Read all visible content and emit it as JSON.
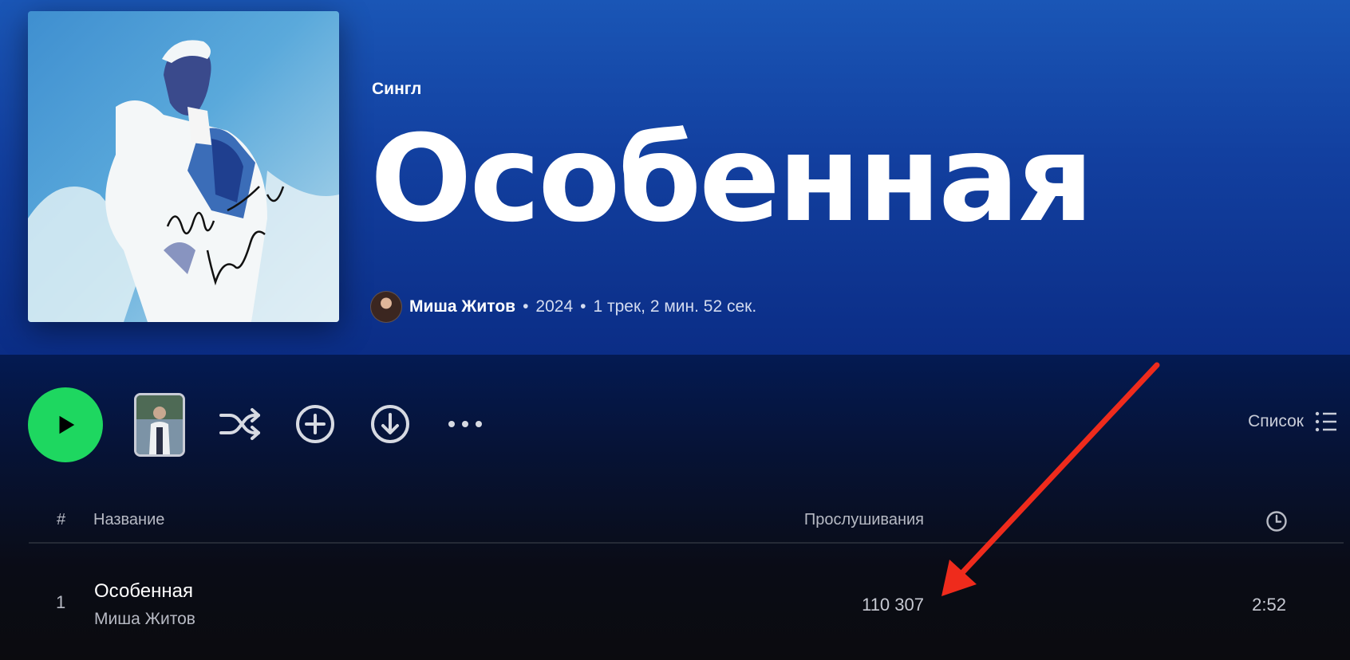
{
  "album": {
    "type_label": "Сингл",
    "title": "Особенная",
    "artist": "Миша Житов",
    "separator": "•",
    "year": "2024",
    "summary": "1 трек, 2 мин. 52 сек.",
    "cover_signature": "Миша Житов"
  },
  "actions": {
    "play_icon": "play-icon",
    "shuffle_icon": "shuffle-icon",
    "add_icon": "add-circle-icon",
    "download_icon": "download-icon",
    "more_icon": "more-horizontal-icon",
    "view_label": "Список",
    "view_icon": "list-icon",
    "accent_color": "#1ed760"
  },
  "tracklist": {
    "headers": {
      "number": "#",
      "title": "Название",
      "plays": "Прослушивания",
      "duration_icon": "clock-icon"
    },
    "tracks": [
      {
        "number": "1",
        "title": "Особенная",
        "artist": "Миша Житов",
        "plays": "110 307",
        "duration": "2:52"
      }
    ]
  },
  "annotation": {
    "type": "arrow",
    "color": "#ef2b1c"
  }
}
